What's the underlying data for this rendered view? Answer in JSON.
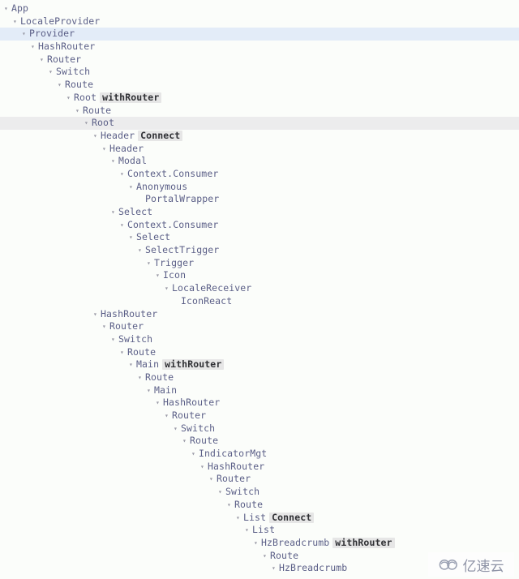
{
  "panel": {
    "name": "react-devtools-component-tree",
    "background_color": "#fbfdfa",
    "text_color": "#5b5f87",
    "selected_blue_color": "#e3ecf8",
    "hover_gray_color": "#ececed",
    "badge_bg_color": "#e6e6e6",
    "arrow_glyph": "▾",
    "arrow_icon_name": "chevron-down-icon"
  },
  "watermark": {
    "text": "亿速云",
    "icon": "cloud-logo-icon"
  },
  "tree": [
    {
      "depth": 0,
      "label": "App",
      "badge": "",
      "state": "none"
    },
    {
      "depth": 1,
      "label": "LocaleProvider",
      "badge": "",
      "state": "none"
    },
    {
      "depth": 2,
      "label": "Provider",
      "badge": "",
      "state": "blue"
    },
    {
      "depth": 3,
      "label": "HashRouter",
      "badge": "",
      "state": "none"
    },
    {
      "depth": 4,
      "label": "Router",
      "badge": "",
      "state": "none"
    },
    {
      "depth": 5,
      "label": "Switch",
      "badge": "",
      "state": "none"
    },
    {
      "depth": 6,
      "label": "Route",
      "badge": "",
      "state": "none"
    },
    {
      "depth": 7,
      "label": "Root",
      "badge": "withRouter",
      "state": "none"
    },
    {
      "depth": 8,
      "label": "Route",
      "badge": "",
      "state": "none"
    },
    {
      "depth": 9,
      "label": "Root",
      "badge": "",
      "state": "gray"
    },
    {
      "depth": 10,
      "label": "Header",
      "badge": "Connect",
      "state": "none"
    },
    {
      "depth": 11,
      "label": "Header",
      "badge": "",
      "state": "none"
    },
    {
      "depth": 12,
      "label": "Modal",
      "badge": "",
      "state": "none"
    },
    {
      "depth": 13,
      "label": "Context.Consumer",
      "badge": "",
      "state": "none"
    },
    {
      "depth": 14,
      "label": "Anonymous",
      "badge": "",
      "state": "none"
    },
    {
      "depth": 15,
      "label": "PortalWrapper",
      "badge": "",
      "state": "none",
      "leaf": true
    },
    {
      "depth": 12,
      "label": "Select",
      "badge": "",
      "state": "none"
    },
    {
      "depth": 13,
      "label": "Context.Consumer",
      "badge": "",
      "state": "none"
    },
    {
      "depth": 14,
      "label": "Select",
      "badge": "",
      "state": "none"
    },
    {
      "depth": 15,
      "label": "SelectTrigger",
      "badge": "",
      "state": "none"
    },
    {
      "depth": 16,
      "label": "Trigger",
      "badge": "",
      "state": "none"
    },
    {
      "depth": 17,
      "label": "Icon",
      "badge": "",
      "state": "none"
    },
    {
      "depth": 18,
      "label": "LocaleReceiver",
      "badge": "",
      "state": "none"
    },
    {
      "depth": 19,
      "label": "IconReact",
      "badge": "",
      "state": "none",
      "leaf": true
    },
    {
      "depth": 10,
      "label": "HashRouter",
      "badge": "",
      "state": "none"
    },
    {
      "depth": 11,
      "label": "Router",
      "badge": "",
      "state": "none"
    },
    {
      "depth": 12,
      "label": "Switch",
      "badge": "",
      "state": "none"
    },
    {
      "depth": 13,
      "label": "Route",
      "badge": "",
      "state": "none"
    },
    {
      "depth": 14,
      "label": "Main",
      "badge": "withRouter",
      "state": "none"
    },
    {
      "depth": 15,
      "label": "Route",
      "badge": "",
      "state": "none"
    },
    {
      "depth": 16,
      "label": "Main",
      "badge": "",
      "state": "none"
    },
    {
      "depth": 17,
      "label": "HashRouter",
      "badge": "",
      "state": "none"
    },
    {
      "depth": 18,
      "label": "Router",
      "badge": "",
      "state": "none"
    },
    {
      "depth": 19,
      "label": "Switch",
      "badge": "",
      "state": "none"
    },
    {
      "depth": 20,
      "label": "Route",
      "badge": "",
      "state": "none"
    },
    {
      "depth": 21,
      "label": "IndicatorMgt",
      "badge": "",
      "state": "none"
    },
    {
      "depth": 22,
      "label": "HashRouter",
      "badge": "",
      "state": "none"
    },
    {
      "depth": 23,
      "label": "Router",
      "badge": "",
      "state": "none"
    },
    {
      "depth": 24,
      "label": "Switch",
      "badge": "",
      "state": "none"
    },
    {
      "depth": 25,
      "label": "Route",
      "badge": "",
      "state": "none"
    },
    {
      "depth": 26,
      "label": "List",
      "badge": "Connect",
      "state": "none"
    },
    {
      "depth": 27,
      "label": "List",
      "badge": "",
      "state": "none"
    },
    {
      "depth": 28,
      "label": "HzBreadcrumb",
      "badge": "withRouter",
      "state": "none"
    },
    {
      "depth": 29,
      "label": "Route",
      "badge": "",
      "state": "none"
    },
    {
      "depth": 30,
      "label": "HzBreadcrumb",
      "badge": "",
      "state": "none"
    }
  ]
}
